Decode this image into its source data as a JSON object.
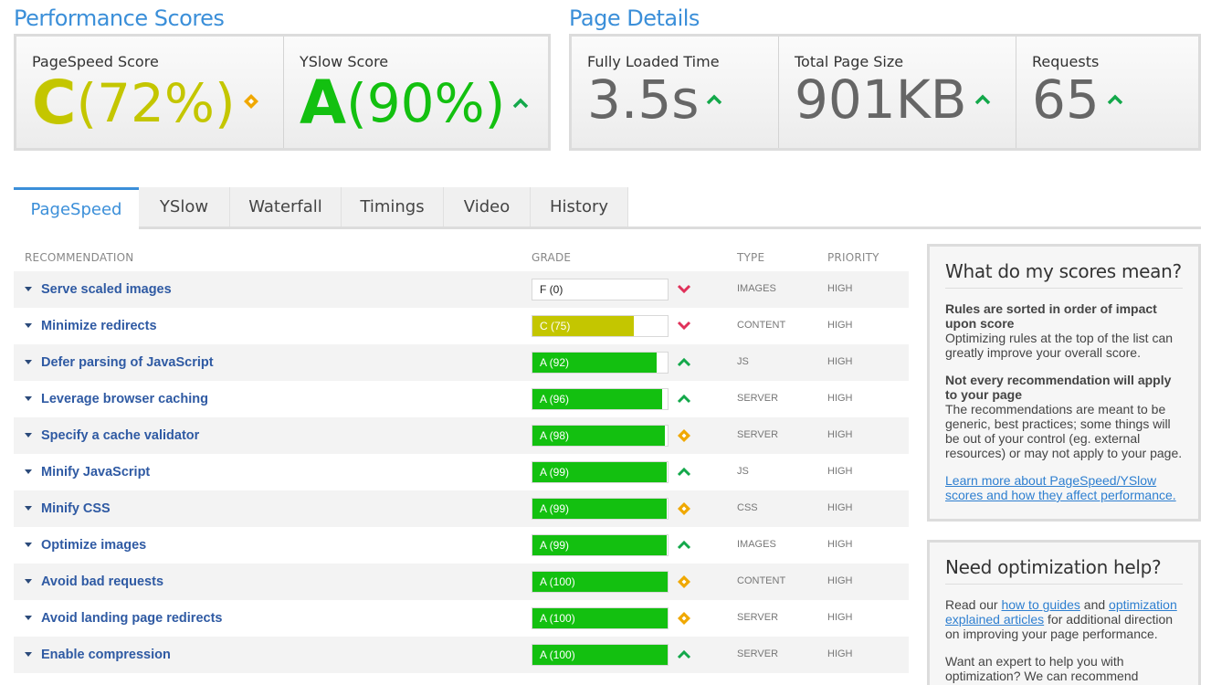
{
  "performance": {
    "title": "Performance Scores",
    "pagespeed": {
      "label": "PageSpeed Score",
      "grade": "C",
      "pct": "(72%)",
      "color": "#c4c600",
      "trend": "neutral"
    },
    "yslow": {
      "label": "YSlow Score",
      "grade": "A",
      "pct": "(90%)",
      "color": "#13c010",
      "trend": "up"
    }
  },
  "details": {
    "title": "Page Details",
    "load_time": {
      "label": "Fully Loaded Time",
      "value": "3.5s",
      "trend": "up"
    },
    "page_size": {
      "label": "Total Page Size",
      "value": "901KB",
      "trend": "up"
    },
    "requests": {
      "label": "Requests",
      "value": "65",
      "trend": "up"
    }
  },
  "tabs": [
    "PageSpeed",
    "YSlow",
    "Waterfall",
    "Timings",
    "Video",
    "History"
  ],
  "table": {
    "headers": {
      "recommendation": "RECOMMENDATION",
      "grade": "GRADE",
      "type": "TYPE",
      "priority": "PRIORITY"
    },
    "rows": [
      {
        "name": "Serve scaled images",
        "grade": "F (0)",
        "score": 0,
        "trend": "down",
        "type": "IMAGES",
        "priority": "HIGH"
      },
      {
        "name": "Minimize redirects",
        "grade": "C (75)",
        "score": 75,
        "trend": "down",
        "type": "CONTENT",
        "priority": "HIGH"
      },
      {
        "name": "Defer parsing of JavaScript",
        "grade": "A (92)",
        "score": 92,
        "trend": "up",
        "type": "JS",
        "priority": "HIGH"
      },
      {
        "name": "Leverage browser caching",
        "grade": "A (96)",
        "score": 96,
        "trend": "up",
        "type": "SERVER",
        "priority": "HIGH"
      },
      {
        "name": "Specify a cache validator",
        "grade": "A (98)",
        "score": 98,
        "trend": "neutral",
        "type": "SERVER",
        "priority": "HIGH"
      },
      {
        "name": "Minify JavaScript",
        "grade": "A (99)",
        "score": 99,
        "trend": "up",
        "type": "JS",
        "priority": "HIGH"
      },
      {
        "name": "Minify CSS",
        "grade": "A (99)",
        "score": 99,
        "trend": "neutral",
        "type": "CSS",
        "priority": "HIGH"
      },
      {
        "name": "Optimize images",
        "grade": "A (99)",
        "score": 99,
        "trend": "up",
        "type": "IMAGES",
        "priority": "HIGH"
      },
      {
        "name": "Avoid bad requests",
        "grade": "A (100)",
        "score": 100,
        "trend": "neutral",
        "type": "CONTENT",
        "priority": "HIGH"
      },
      {
        "name": "Avoid landing page redirects",
        "grade": "A (100)",
        "score": 100,
        "trend": "neutral",
        "type": "SERVER",
        "priority": "HIGH"
      },
      {
        "name": "Enable compression",
        "grade": "A (100)",
        "score": 100,
        "trend": "up",
        "type": "SERVER",
        "priority": "HIGH"
      }
    ]
  },
  "colors": {
    "grade_a": "#13c010",
    "grade_c": "#c4c600",
    "trend_up": "#13a84a",
    "trend_down": "#e0315a",
    "trend_neutral": "#f0a800",
    "accent": "#3b8fd9"
  },
  "sidebar": {
    "scores": {
      "title": "What do my scores mean?",
      "p1_bold": "Rules are sorted in order of impact upon score",
      "p1_text": "Optimizing rules at the top of the list can greatly improve your overall score.",
      "p2_bold": "Not every recommendation will apply to your page",
      "p2_text": "The recommendations are meant to be generic, best practices; some things will be out of your control (eg. external resources) or may not apply to your page.",
      "link": "Learn more about PageSpeed/YSlow scores and how they affect performance."
    },
    "help": {
      "title": "Need optimization help?",
      "t1": "Read our ",
      "link1": "how to guides",
      "t2": " and ",
      "link2": "optimization explained articles",
      "t3": " for additional direction on improving your page performance.",
      "p2": "Want an expert to help you with optimization? We can recommend"
    }
  }
}
